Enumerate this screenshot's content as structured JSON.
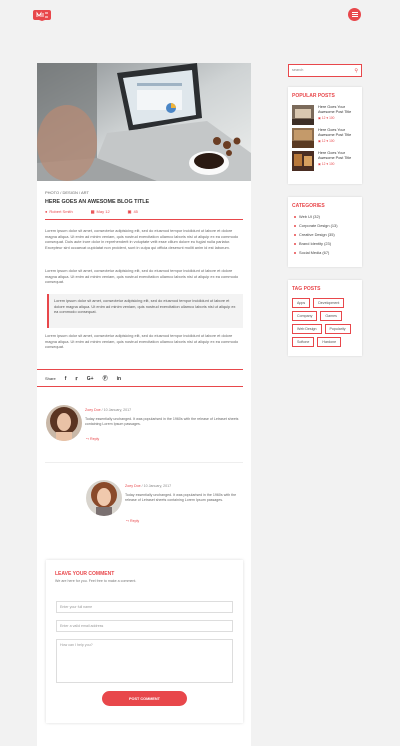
{
  "colors": {
    "accent": "#e8474b",
    "page_bg": "#f2f2f2"
  },
  "header": {
    "logo_icon": "logo-icon",
    "menu_icon": "hamburger-icon"
  },
  "post": {
    "breadcrumb": [
      "PHOTO",
      "DESIGN",
      "ART"
    ],
    "title": "HERE GOES AN AWESOME BLOG TITLE",
    "author": "Robert Smith",
    "date": "May 12",
    "comments": "45",
    "paragraphs": [
      "Lorem ipsum dolor sit amet, consectetur adipisicing elit, sed do eiusmod tempor incididunt ut labore et dolore magna aliqua. Ut enim ad minim veniam, quis nostrud exercitation ullamco laboris nisi ut aliquip ex ea commodo consequat. Duis aute irure dolor in reprehenderit in voluptate velit esse cillum dolore eu fugiat nulla pariatur. Excepteur sint occaecat cupidatat non proident, sunt in culpa qui officia deserunt mollit anim id est laborum.",
      "Lorem ipsum dolor sit amet, consectetur adipisicing elit, sed do eiusmod tempor incididunt ut labore et dolore magna aliqua. Ut enim ad minim veniam, quis nostrud exercitation ullamco laboris nisi ut aliquip ex ea commodo consequat.",
      "Lorem ipsum dolor sit amet, consectetur adipisicing elit, sed do eiusmod tempor incididunt ut labore et dolore magna aliqua. Ut enim ad minim veniam, quis nostrud exercitation ullamco laboris nisi ut aliquip ex ea commodo consequat."
    ],
    "quote": "Lorem ipsum dolor sit amet, consectetur adipisicing elit, sed do eiusmod tempor incididunt ut labore et dolore magna aliqua. Ut enim ad minim veniam, quis nostrud exercitation ullamco laboris nisi ut aliquip ex ea commodo consequat.",
    "share_label": "Share",
    "share_icons": [
      "facebook-icon",
      "twitter-icon",
      "google-plus-icon",
      "pinterest-icon",
      "linkedin-icon"
    ]
  },
  "comments": [
    {
      "name": "Zoey Doe",
      "date": "/ 10 January, 2017",
      "text": "Today essentially unchanged. It was popularised in the 1960s with the release of Letraset sheets containing Lorem Ipsum passages.",
      "reply": "Reply"
    },
    {
      "name": "Zoey Doe",
      "date": "/ 10 January, 2017",
      "text": "Today essentially unchanged. It was popularised in the 1960s with the release of Letraset sheets containing Lorem Ipsum passages.",
      "reply": "Reply"
    }
  ],
  "form": {
    "title": "LEAVE YOUR COMMENT",
    "subtitle": "We are here for you. Feel free to make a comment.",
    "name_placeholder": "Enter your full name",
    "email_placeholder": "Enter a valid email address",
    "message_placeholder": "How can I help you?",
    "submit": "POST COMMENT"
  },
  "sidebar": {
    "search_placeholder": "search",
    "popular_title": "POPULAR POSTS",
    "popular": [
      {
        "title": "Here Goes Your Awesome Post Title",
        "comments": "12",
        "likes": "100"
      },
      {
        "title": "Here Goes Your Awesome Post Title",
        "comments": "12",
        "likes": "100"
      },
      {
        "title": "Here Goes Your Awesome Post Title",
        "comments": "12",
        "likes": "100"
      }
    ],
    "categories_title": "CATEGORIES",
    "categories": [
      "Web UI (32)",
      "Corporate Design (13)",
      "Creative Design (35)",
      "Brand Identity (23)",
      "Social Media (67)"
    ],
    "tags_title": "TAG POSTS",
    "tags": [
      "Apps",
      "Development",
      "Company",
      "Games",
      "Web Design",
      "Popularity",
      "Softone",
      "Hardone"
    ]
  }
}
